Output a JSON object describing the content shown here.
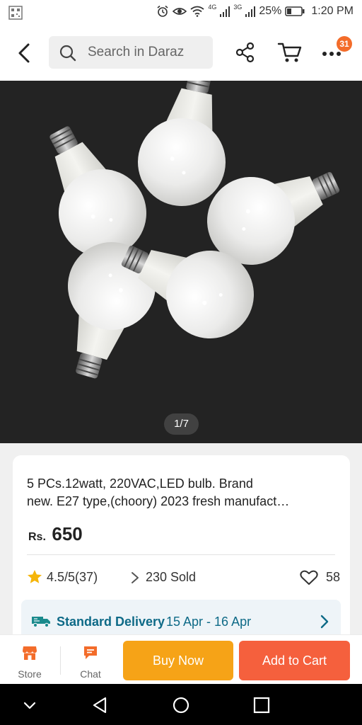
{
  "status_bar": {
    "time": "1:20 PM",
    "battery": "25%",
    "net_4g": "4G",
    "net_3g": "3G"
  },
  "header": {
    "search_placeholder": "Search in Daraz",
    "cart_badge": "31"
  },
  "gallery": {
    "indicator": "1/7"
  },
  "product": {
    "title_line1": "5 PCs.12watt, 220VAC,LED bulb. Brand",
    "title_line2": "new. E27 type,(choory) 2023 fresh manufact…",
    "currency": "Rs.",
    "price": "650",
    "rating": "4.5/5",
    "rating_count": "(37)",
    "sold": "230 Sold",
    "likes": "58"
  },
  "delivery": {
    "label": "Standard Delivery",
    "dates": "15 Apr - 16 Apr"
  },
  "bottom_bar": {
    "store_label": "Store",
    "chat_label": "Chat",
    "buy_now": "Buy Now",
    "add_to_cart": "Add to Cart"
  },
  "colors": {
    "accent_orange": "#f36c2a",
    "buy_now": "#f6a317",
    "add_to_cart": "#f5603d",
    "delivery_text": "#0e6a87",
    "star": "#f5b50a"
  }
}
